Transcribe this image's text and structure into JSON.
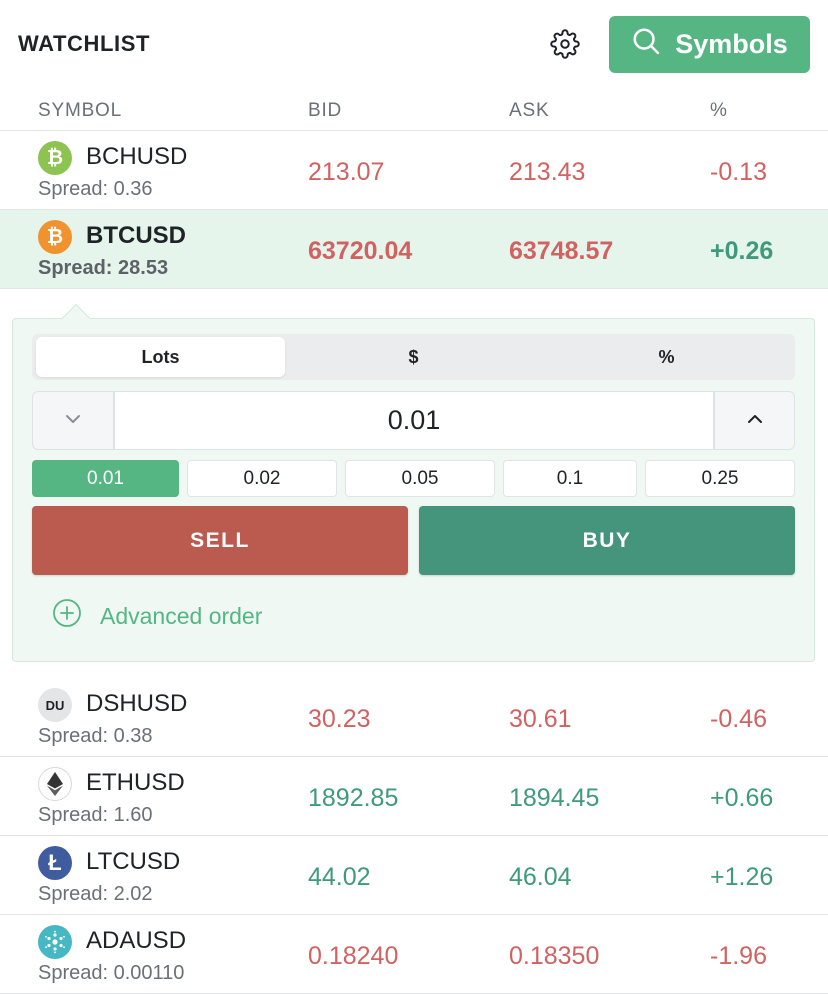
{
  "header": {
    "title": "WATCHLIST",
    "symbols_label": "Symbols"
  },
  "columns": {
    "symbol": "SYMBOL",
    "bid": "BID",
    "ask": "ASK",
    "pct": "%"
  },
  "colors": {
    "accent": "#55b684",
    "sell": "#bb5a4f",
    "buy": "#45957c",
    "up": "#3f9a7c",
    "down": "#d16262"
  },
  "rows": [
    {
      "symbol": "BCHUSD",
      "spread": "Spread: 0.36",
      "bid": "213.07",
      "ask": "213.43",
      "pct": "-0.13",
      "icon": "bitcoin-cash-icon",
      "glyph": "₿",
      "trend": "down"
    },
    {
      "symbol": "BTCUSD",
      "spread": "Spread: 28.53",
      "bid": "63720.04",
      "ask": "63748.57",
      "pct": "+0.26",
      "icon": "bitcoin-icon",
      "glyph": "₿",
      "trend": "up"
    },
    {
      "symbol": "DSHUSD",
      "spread": "Spread: 0.38",
      "bid": "30.23",
      "ask": "30.61",
      "pct": "-0.46",
      "icon": "du-badge-icon",
      "glyph": "DU",
      "trend": "down"
    },
    {
      "symbol": "ETHUSD",
      "spread": "Spread: 1.60",
      "bid": "1892.85",
      "ask": "1894.45",
      "pct": "+0.66",
      "icon": "ethereum-icon",
      "glyph": "",
      "trend": "up"
    },
    {
      "symbol": "LTCUSD",
      "spread": "Spread: 2.02",
      "bid": "44.02",
      "ask": "46.04",
      "pct": "+1.26",
      "icon": "litecoin-icon",
      "glyph": "Ł",
      "trend": "up"
    },
    {
      "symbol": "ADAUSD",
      "spread": "Spread: 0.00110",
      "bid": "0.18240",
      "ask": "0.18350",
      "pct": "-1.96",
      "icon": "cardano-icon",
      "glyph": "",
      "trend": "down"
    }
  ],
  "trade": {
    "units": [
      "Lots",
      "$",
      "%"
    ],
    "active_unit": "Lots",
    "quantity": "0.01",
    "presets": [
      "0.01",
      "0.02",
      "0.05",
      "0.1",
      "0.25"
    ],
    "active_preset": "0.01",
    "sell_label": "SELL",
    "buy_label": "BUY",
    "advanced_label": "Advanced order"
  }
}
